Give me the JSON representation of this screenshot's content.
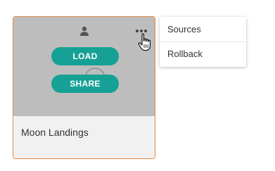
{
  "card": {
    "title": "Moon Landings",
    "load_label": "LOAD",
    "share_label": "SHARE",
    "accent_color": "#e4883f",
    "button_color": "#16a196",
    "thumbnail_bg": "#bdbdbd"
  },
  "menu": {
    "items": [
      {
        "label": "Sources"
      },
      {
        "label": "Rollback"
      }
    ]
  },
  "icons": {
    "owner": "person-icon",
    "more": "more-options-icon",
    "cursor": "hand-pointer-cursor"
  }
}
